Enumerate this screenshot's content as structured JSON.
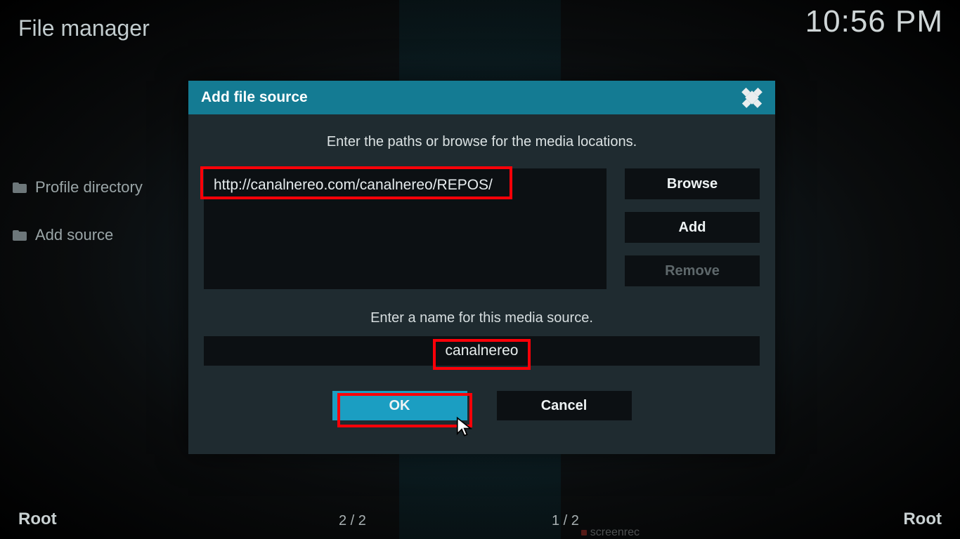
{
  "header": {
    "title": "File manager",
    "time": "10:56 PM"
  },
  "sidebar": {
    "items": [
      {
        "label": "Profile directory"
      },
      {
        "label": "Add source"
      }
    ]
  },
  "dialog": {
    "title": "Add file source",
    "instruction": "Enter the paths or browse for the media locations.",
    "path": "http://canalnereo.com/canalnereo/REPOS/",
    "browse_label": "Browse",
    "add_label": "Add",
    "remove_label": "Remove",
    "name_label": "Enter a name for this media source.",
    "name_value": "canalnereo",
    "ok_label": "OK",
    "cancel_label": "Cancel"
  },
  "footer": {
    "left_title": "Root",
    "left_count": "2 / 2",
    "right_title": "Root",
    "right_count": "1 / 2"
  },
  "watermark": "screenrec"
}
